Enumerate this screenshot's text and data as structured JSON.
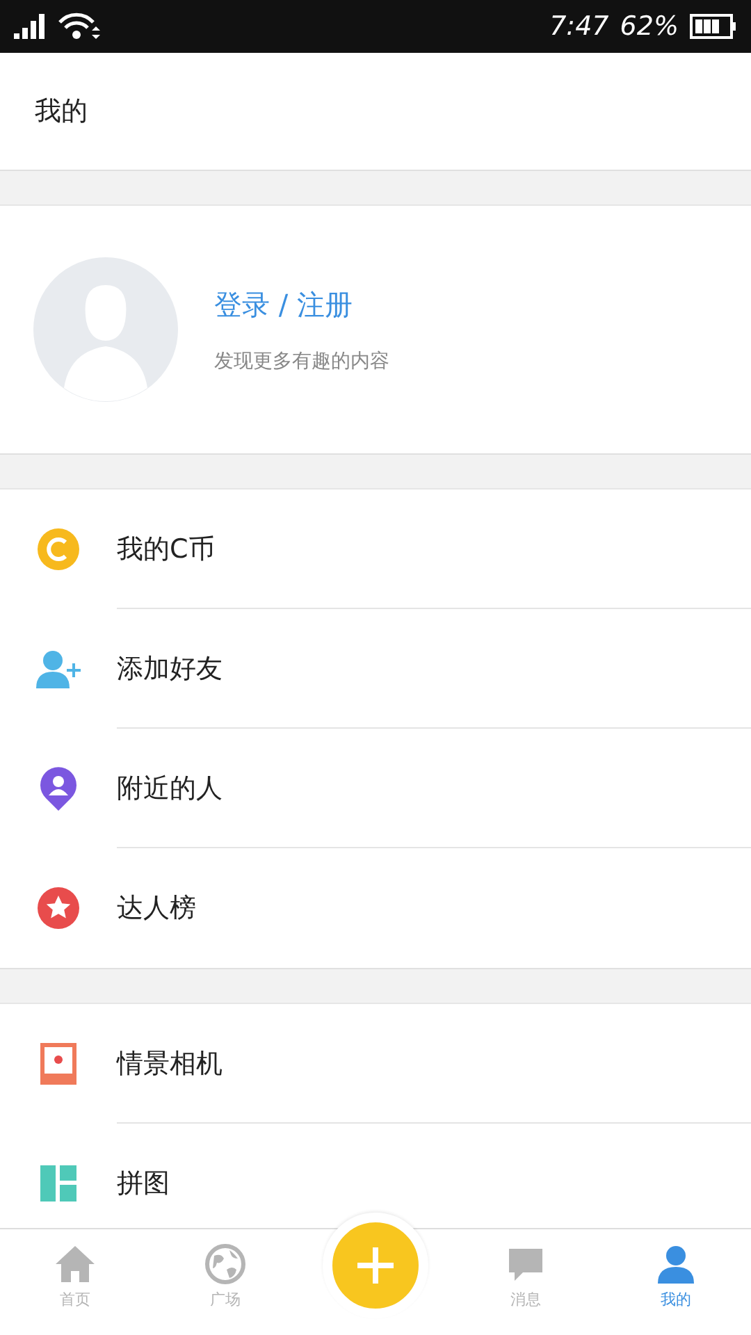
{
  "status_bar": {
    "time": "7:47",
    "battery": "62%"
  },
  "header": {
    "title": "我的"
  },
  "profile": {
    "login": "登录 / 注册",
    "subtitle": "发现更多有趣的内容"
  },
  "sections": [
    {
      "items": [
        {
          "kind": "coin",
          "label": "我的C币"
        },
        {
          "kind": "add-friend",
          "label": "添加好友"
        },
        {
          "kind": "nearby",
          "label": "附近的人"
        },
        {
          "kind": "star",
          "label": "达人榜"
        }
      ]
    },
    {
      "items": [
        {
          "kind": "camera",
          "label": "情景相机"
        },
        {
          "kind": "collage",
          "label": "拼图"
        }
      ]
    }
  ],
  "tab_bar": [
    {
      "kind": "home",
      "label": "首页",
      "selected": false
    },
    {
      "kind": "globe",
      "label": "广场",
      "selected": false
    },
    {
      "kind": "add"
    },
    {
      "kind": "chat",
      "label": "消息",
      "selected": false
    },
    {
      "kind": "person",
      "label": "我的",
      "selected": true
    }
  ]
}
